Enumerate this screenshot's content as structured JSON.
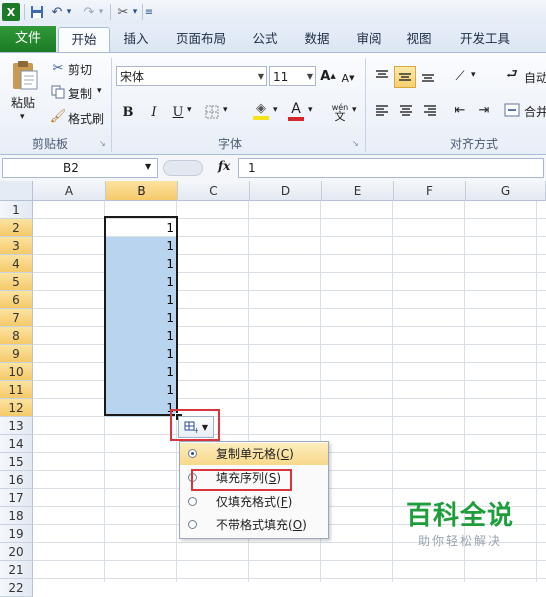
{
  "qat": {
    "undo_arrow": "▾",
    "redo_arrow": "▾",
    "customize": "▾"
  },
  "tabs": [
    "文件",
    "开始",
    "插入",
    "页面布局",
    "公式",
    "数据",
    "审阅",
    "视图",
    "开发工具"
  ],
  "ribbon": {
    "clipboard": {
      "paste": "粘贴",
      "cut": "剪切",
      "copy": "复制",
      "format_painter": "格式刷",
      "group_label": "剪贴板"
    },
    "font": {
      "font_name": "宋体",
      "font_size": "11",
      "bold": "B",
      "italic": "I",
      "underline": "U",
      "phonetic": "wén",
      "group_label": "字体"
    },
    "alignment": {
      "wrap": "自动",
      "merge": "合并",
      "group_label": "对齐方式"
    }
  },
  "formula_bar": {
    "name_box": "B2",
    "fx": "fx",
    "value": "1"
  },
  "sheet": {
    "columns": [
      "A",
      "B",
      "C",
      "D",
      "E",
      "F",
      "G"
    ],
    "rows": [
      "1",
      "2",
      "3",
      "4",
      "5",
      "6",
      "7",
      "8",
      "9",
      "10",
      "11",
      "12",
      "13",
      "14",
      "15",
      "16",
      "17",
      "18",
      "19",
      "20",
      "21",
      "22"
    ],
    "selected_column": "B",
    "selected_rows": [
      "2",
      "3",
      "4",
      "5",
      "6",
      "7",
      "8",
      "9",
      "10",
      "11",
      "12"
    ],
    "b_values": [
      "1",
      "1",
      "1",
      "1",
      "1",
      "1",
      "1",
      "1",
      "1",
      "1",
      "1"
    ]
  },
  "autofill_menu": {
    "items": [
      {
        "label": "复制单元格(C)",
        "text": "复制单元格(",
        "key": "C",
        "checked": true
      },
      {
        "label": "填充序列(S)",
        "text": "填充序列(",
        "key": "S",
        "checked": false
      },
      {
        "label": "仅填充格式(F)",
        "text": "仅填充格式(",
        "key": "F",
        "checked": false
      },
      {
        "label": "不带格式填充(O)",
        "text": "不带格式填充(",
        "key": "O",
        "checked": false
      }
    ]
  },
  "watermark": {
    "title": "百科全说",
    "subtitle": "助你轻松解决"
  },
  "colors": {
    "file_tab": "#1d7a26",
    "selection_fill": "#b8d4ef",
    "highlight_red": "#d9353c",
    "header_selected": "#f5c969",
    "watermark_green": "#1e9d3b"
  }
}
